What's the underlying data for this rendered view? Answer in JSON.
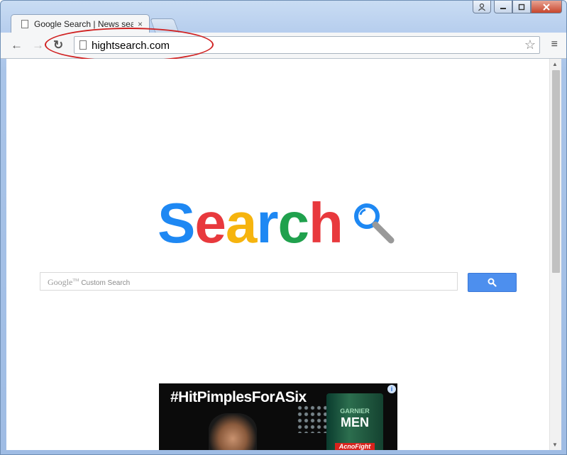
{
  "window": {
    "controls": {
      "user_icon": "user-icon",
      "minimize": "minimize-icon",
      "maximize": "maximize-icon",
      "close": "close-icon"
    }
  },
  "tabs": [
    {
      "title": "Google Search | News sea",
      "close_glyph": "×"
    }
  ],
  "toolbar": {
    "back_glyph": "←",
    "forward_glyph": "→",
    "reload_glyph": "↻",
    "url": "hightsearch.com",
    "star_glyph": "☆",
    "menu_glyph": "≡"
  },
  "annotation": {
    "color": "#d02020"
  },
  "page": {
    "logo_letters": [
      {
        "char": "S",
        "color": "#1e88f3"
      },
      {
        "char": "e",
        "color": "#e8393d"
      },
      {
        "char": "a",
        "color": "#f6b40e"
      },
      {
        "char": "r",
        "color": "#1e88f3"
      },
      {
        "char": "c",
        "color": "#20a14d"
      },
      {
        "char": "h",
        "color": "#e8393d"
      }
    ],
    "search": {
      "brand": "Google",
      "brand_tm": "TM",
      "placeholder": "Custom Search",
      "button_color": "#4d8fee"
    },
    "ad": {
      "headline": "#HitPimplesForASix",
      "product_brand": "GARNIER",
      "product_line": "MEN",
      "product_name": "AcnoFight",
      "info_glyph": "i"
    }
  }
}
